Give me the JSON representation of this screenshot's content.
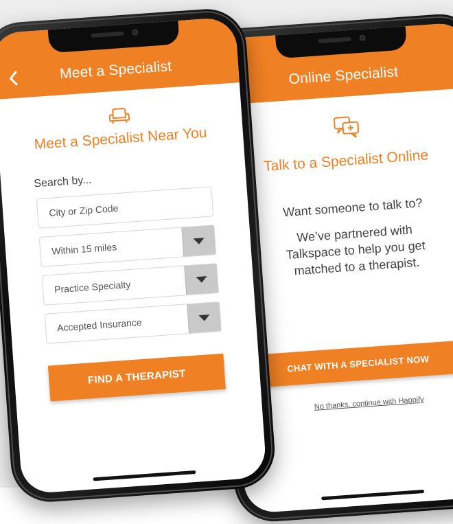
{
  "colors": {
    "brand": "#f08024",
    "dropdown_gray": "#c9c9c9"
  },
  "phone_left": {
    "appbar_title": "Meet a Specialist",
    "back_icon": "chevron-left-icon",
    "hero_icon": "sofa-icon",
    "heading": "Meet a Specialist Near You",
    "search_label": "Search by...",
    "location_placeholder": "City or Zip Code",
    "distance_value": "Within 15 miles",
    "specialty_value": "Practice Specialty",
    "insurance_value": "Accepted Insurance",
    "dropdown_icon": "caret-down-icon",
    "cta_label": "FIND A THERAPIST"
  },
  "phone_right": {
    "appbar_title": "Online Specialist",
    "hero_icon": "chat-bubbles-icon",
    "heading": "Talk to a Specialist Online",
    "question": "Want someone to talk to?",
    "body_lines": [
      "We’ve partnered with",
      "Talkspace to help you get",
      "matched to a therapist."
    ],
    "cta_label": "CHAT WITH A SPECIALIST NOW",
    "decline_link": "No thanks, continue with Happify"
  }
}
